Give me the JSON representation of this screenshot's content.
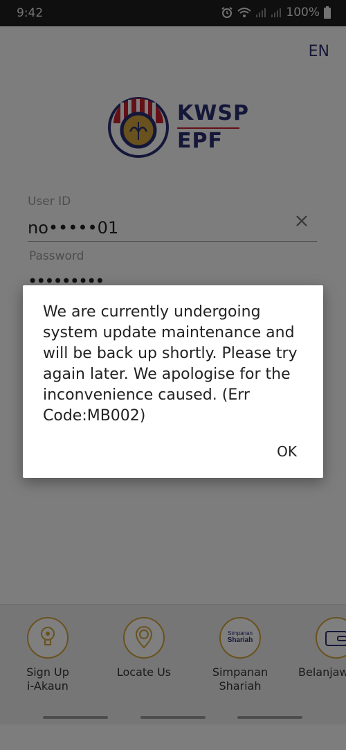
{
  "status_bar": {
    "time": "9:42",
    "battery": "100%"
  },
  "header": {
    "language": "EN"
  },
  "logo": {
    "line1": "KWSP",
    "line2": "EPF"
  },
  "login": {
    "user_id_label": "User ID",
    "user_id_value": "no•••••01",
    "password_label": "Password",
    "password_value": "•••••••••"
  },
  "bottom_menu": [
    {
      "label_line1": "Sign Up",
      "label_line2": "i-Akaun",
      "icon": "signup-icon"
    },
    {
      "label_line1": "Locate Us",
      "label_line2": "",
      "icon": "location-pin-icon"
    },
    {
      "label_line1": "Simpanan",
      "label_line2": "Shariah",
      "icon": "simpanan-shariah-icon",
      "icon_text1": "Simpanan",
      "icon_text2": "Shariah"
    },
    {
      "label_line1": "Belanjawan",
      "label_line2": "",
      "icon": "wallet-icon"
    }
  ],
  "dialog": {
    "message": "We are currently undergoing system update maintenance and will be back up shortly. Please try again later. We apologise for the inconvenience caused. (Err Code:MB002)",
    "ok_label": "OK"
  },
  "colors": {
    "brand_navy": "#2b2e73",
    "brand_red": "#c8202e",
    "brand_gold": "#d3a53b"
  }
}
